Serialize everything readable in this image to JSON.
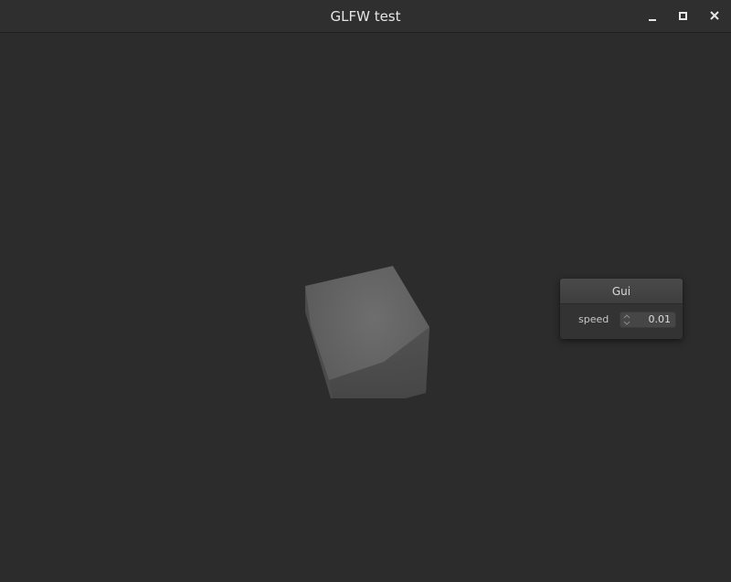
{
  "window": {
    "title": "GLFW test",
    "controls": {
      "minimize_icon": "minimize-icon",
      "maximize_icon": "maximize-icon",
      "close_icon": "close-icon"
    }
  },
  "viewport": {
    "background": "#2c2c2c",
    "object": "cube"
  },
  "gui": {
    "title": "Gui",
    "fields": [
      {
        "label": "speed",
        "value": "0.01",
        "icon": "spinner-arrows-icon"
      }
    ]
  },
  "colors": {
    "titlebar": "#2f2f2f",
    "title_text": "#e6e6e6",
    "panel": "#333333",
    "panel_header": "#444444",
    "field": "#464646"
  }
}
